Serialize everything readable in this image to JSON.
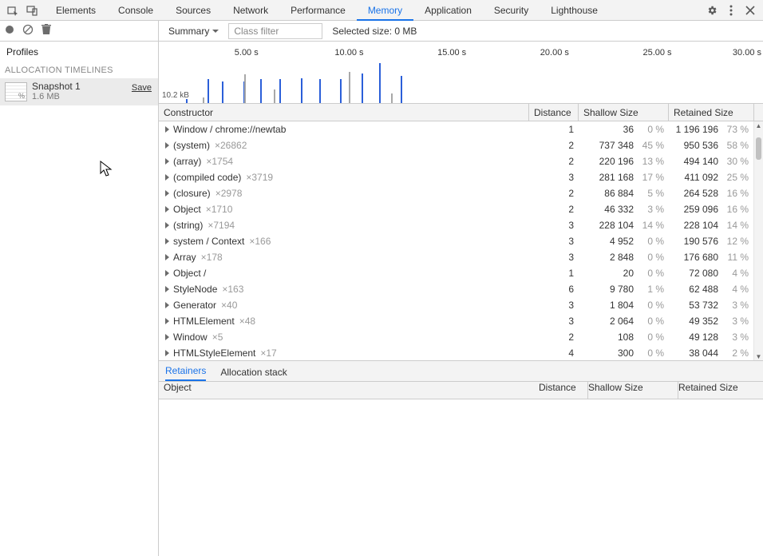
{
  "topTabs": [
    "Elements",
    "Console",
    "Sources",
    "Network",
    "Performance",
    "Memory",
    "Application",
    "Security",
    "Lighthouse"
  ],
  "activeTopTab": 5,
  "toolbar": {
    "summary_label": "Summary",
    "class_filter_placeholder": "Class filter",
    "selected_size": "Selected size: 0 MB"
  },
  "side": {
    "profiles_label": "Profiles",
    "timelines_label": "ALLOCATION TIMELINES",
    "snapshot_name": "Snapshot 1",
    "snapshot_size": "1.6 MB",
    "save_label": "Save"
  },
  "timeline": {
    "ticks": [
      {
        "label": "5.00 s",
        "x": 0.145,
        "major": true
      },
      {
        "label": "10.00 s",
        "x": 0.315,
        "major": true
      },
      {
        "label": "15.00 s",
        "x": 0.485,
        "major": true
      },
      {
        "label": "20.00 s",
        "x": 0.655,
        "major": true
      },
      {
        "label": "25.00 s",
        "x": 0.825,
        "major": true
      },
      {
        "label": "30.00 s",
        "x": 0.995,
        "major": true,
        "edge": true
      }
    ],
    "y_label": "10.2 kB",
    "bars": [
      {
        "x": 0.045,
        "h": 0.1,
        "grey": false
      },
      {
        "x": 0.072,
        "h": 0.15,
        "grey": true
      },
      {
        "x": 0.08,
        "h": 0.6,
        "grey": false
      },
      {
        "x": 0.105,
        "h": 0.55,
        "grey": false
      },
      {
        "x": 0.14,
        "h": 0.55,
        "grey": false
      },
      {
        "x": 0.142,
        "h": 0.72,
        "grey": true
      },
      {
        "x": 0.168,
        "h": 0.6,
        "grey": false
      },
      {
        "x": 0.19,
        "h": 0.35,
        "grey": true
      },
      {
        "x": 0.2,
        "h": 0.6,
        "grey": false
      },
      {
        "x": 0.235,
        "h": 0.62,
        "grey": false
      },
      {
        "x": 0.265,
        "h": 0.6,
        "grey": false
      },
      {
        "x": 0.3,
        "h": 0.6,
        "grey": false
      },
      {
        "x": 0.315,
        "h": 0.78,
        "grey": true
      },
      {
        "x": 0.335,
        "h": 0.75,
        "grey": false
      },
      {
        "x": 0.365,
        "h": 1.0,
        "grey": false
      },
      {
        "x": 0.385,
        "h": 0.25,
        "grey": true
      },
      {
        "x": 0.4,
        "h": 0.68,
        "grey": false
      }
    ]
  },
  "grid": {
    "headers": {
      "constructor": "Constructor",
      "distance": "Distance",
      "shallow": "Shallow Size",
      "retained": "Retained Size"
    },
    "rows": [
      {
        "name": "Window / chrome://newtab",
        "count": "",
        "distance": "1",
        "shallow": "36",
        "shallow_pct": "0 %",
        "retained": "1 196 196",
        "retained_pct": "73 %"
      },
      {
        "name": "(system)",
        "count": "×26862",
        "distance": "2",
        "shallow": "737 348",
        "shallow_pct": "45 %",
        "retained": "950 536",
        "retained_pct": "58 %"
      },
      {
        "name": "(array)",
        "count": "×1754",
        "distance": "2",
        "shallow": "220 196",
        "shallow_pct": "13 %",
        "retained": "494 140",
        "retained_pct": "30 %"
      },
      {
        "name": "(compiled code)",
        "count": "×3719",
        "distance": "3",
        "shallow": "281 168",
        "shallow_pct": "17 %",
        "retained": "411 092",
        "retained_pct": "25 %"
      },
      {
        "name": "(closure)",
        "count": "×2978",
        "distance": "2",
        "shallow": "86 884",
        "shallow_pct": "5 %",
        "retained": "264 528",
        "retained_pct": "16 %"
      },
      {
        "name": "Object",
        "count": "×1710",
        "distance": "2",
        "shallow": "46 332",
        "shallow_pct": "3 %",
        "retained": "259 096",
        "retained_pct": "16 %"
      },
      {
        "name": "(string)",
        "count": "×7194",
        "distance": "3",
        "shallow": "228 104",
        "shallow_pct": "14 %",
        "retained": "228 104",
        "retained_pct": "14 %"
      },
      {
        "name": "system / Context",
        "count": "×166",
        "distance": "3",
        "shallow": "4 952",
        "shallow_pct": "0 %",
        "retained": "190 576",
        "retained_pct": "12 %"
      },
      {
        "name": "Array",
        "count": "×178",
        "distance": "3",
        "shallow": "2 848",
        "shallow_pct": "0 %",
        "retained": "176 680",
        "retained_pct": "11 %"
      },
      {
        "name": "Object /",
        "count": "",
        "distance": "1",
        "shallow": "20",
        "shallow_pct": "0 %",
        "retained": "72 080",
        "retained_pct": "4 %"
      },
      {
        "name": "StyleNode",
        "count": "×163",
        "distance": "6",
        "shallow": "9 780",
        "shallow_pct": "1 %",
        "retained": "62 488",
        "retained_pct": "4 %"
      },
      {
        "name": "Generator",
        "count": "×40",
        "distance": "3",
        "shallow": "1 804",
        "shallow_pct": "0 %",
        "retained": "53 732",
        "retained_pct": "3 %"
      },
      {
        "name": "HTMLElement",
        "count": "×48",
        "distance": "3",
        "shallow": "2 064",
        "shallow_pct": "0 %",
        "retained": "49 352",
        "retained_pct": "3 %"
      },
      {
        "name": "Window",
        "count": "×5",
        "distance": "2",
        "shallow": "108",
        "shallow_pct": "0 %",
        "retained": "49 128",
        "retained_pct": "3 %"
      },
      {
        "name": "HTMLStyleElement",
        "count": "×17",
        "distance": "4",
        "shallow": "300",
        "shallow_pct": "0 %",
        "retained": "38 044",
        "retained_pct": "2 %"
      }
    ]
  },
  "detail": {
    "tabs": [
      "Retainers",
      "Allocation stack"
    ],
    "activeTab": 0,
    "headers": {
      "object": "Object",
      "distance": "Distance",
      "shallow": "Shallow Size",
      "retained": "Retained Size"
    }
  }
}
